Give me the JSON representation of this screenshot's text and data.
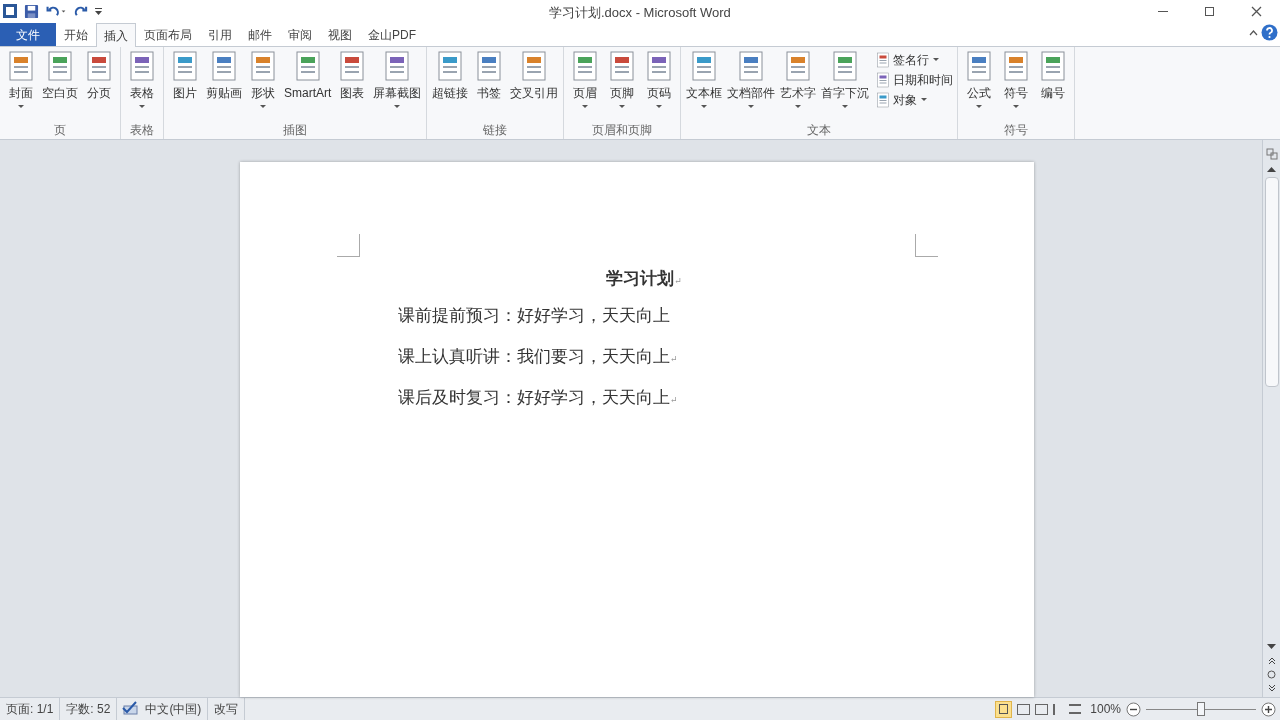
{
  "window": {
    "title": "学习计划.docx - Microsoft Word"
  },
  "tabs": [
    {
      "label": "文件",
      "kind": "file",
      "selected": false
    },
    {
      "label": "开始",
      "kind": "tab",
      "selected": false
    },
    {
      "label": "插入",
      "kind": "tab",
      "selected": true
    },
    {
      "label": "页面布局",
      "kind": "tab",
      "selected": false
    },
    {
      "label": "引用",
      "kind": "tab",
      "selected": false
    },
    {
      "label": "邮件",
      "kind": "tab",
      "selected": false
    },
    {
      "label": "审阅",
      "kind": "tab",
      "selected": false
    },
    {
      "label": "视图",
      "kind": "tab",
      "selected": false
    },
    {
      "label": "金山PDF",
      "kind": "tab",
      "selected": false
    }
  ],
  "ribbon_groups": [
    {
      "label": "页",
      "buttons": [
        {
          "label": "封面",
          "kind": "large",
          "dropdown": true
        },
        {
          "label": "空白页",
          "kind": "large",
          "dropdown": false
        },
        {
          "label": "分页",
          "kind": "large",
          "dropdown": false
        }
      ]
    },
    {
      "label": "表格",
      "buttons": [
        {
          "label": "表格",
          "kind": "large",
          "dropdown": true
        }
      ]
    },
    {
      "label": "插图",
      "buttons": [
        {
          "label": "图片",
          "kind": "large",
          "dropdown": false
        },
        {
          "label": "剪贴画",
          "kind": "large",
          "dropdown": false
        },
        {
          "label": "形状",
          "kind": "large",
          "dropdown": true
        },
        {
          "label": "SmartArt",
          "kind": "large",
          "dropdown": false
        },
        {
          "label": "图表",
          "kind": "large",
          "dropdown": false
        },
        {
          "label": "屏幕截图",
          "kind": "large",
          "dropdown": true
        }
      ]
    },
    {
      "label": "链接",
      "buttons": [
        {
          "label": "超链接",
          "kind": "large",
          "dropdown": false
        },
        {
          "label": "书签",
          "kind": "large",
          "dropdown": false
        },
        {
          "label": "交叉引用",
          "kind": "large",
          "dropdown": false
        }
      ]
    },
    {
      "label": "页眉和页脚",
      "buttons": [
        {
          "label": "页眉",
          "kind": "large",
          "dropdown": true
        },
        {
          "label": "页脚",
          "kind": "large",
          "dropdown": true
        },
        {
          "label": "页码",
          "kind": "large",
          "dropdown": true
        }
      ]
    },
    {
      "label": "文本",
      "buttons": [
        {
          "label": "文本框",
          "kind": "large",
          "dropdown": true
        },
        {
          "label": "文档部件",
          "kind": "large",
          "dropdown": true
        },
        {
          "label": "艺术字",
          "kind": "large",
          "dropdown": true
        },
        {
          "label": "首字下沉",
          "kind": "large",
          "dropdown": true
        },
        {
          "label": "签名行",
          "kind": "small",
          "dropdown": true
        },
        {
          "label": "日期和时间",
          "kind": "small",
          "dropdown": false
        },
        {
          "label": "对象",
          "kind": "small",
          "dropdown": true
        }
      ]
    },
    {
      "label": "符号",
      "buttons": [
        {
          "label": "公式",
          "kind": "large",
          "dropdown": true
        },
        {
          "label": "符号",
          "kind": "large",
          "dropdown": true
        },
        {
          "label": "编号",
          "kind": "large",
          "dropdown": false
        }
      ]
    }
  ],
  "document": {
    "paragraphs": [
      {
        "text": "学习计划",
        "kind": "title",
        "mark": "↵"
      },
      {
        "text": "课前提前预习：好好学习，天天向上",
        "kind": "body"
      },
      {
        "text": "课上认真听讲：我们要习，天天向上",
        "kind": "body",
        "mark": "↵"
      },
      {
        "text": "课后及时复习：好好学习，天天向上",
        "kind": "body",
        "mark": "↵"
      }
    ]
  },
  "status_bar": {
    "items": [
      "页面: 1/1",
      "字数: 52",
      "中文(中国)",
      "改写"
    ],
    "zoom": "100%",
    "zoom_slider": {
      "level": 0.5
    }
  }
}
